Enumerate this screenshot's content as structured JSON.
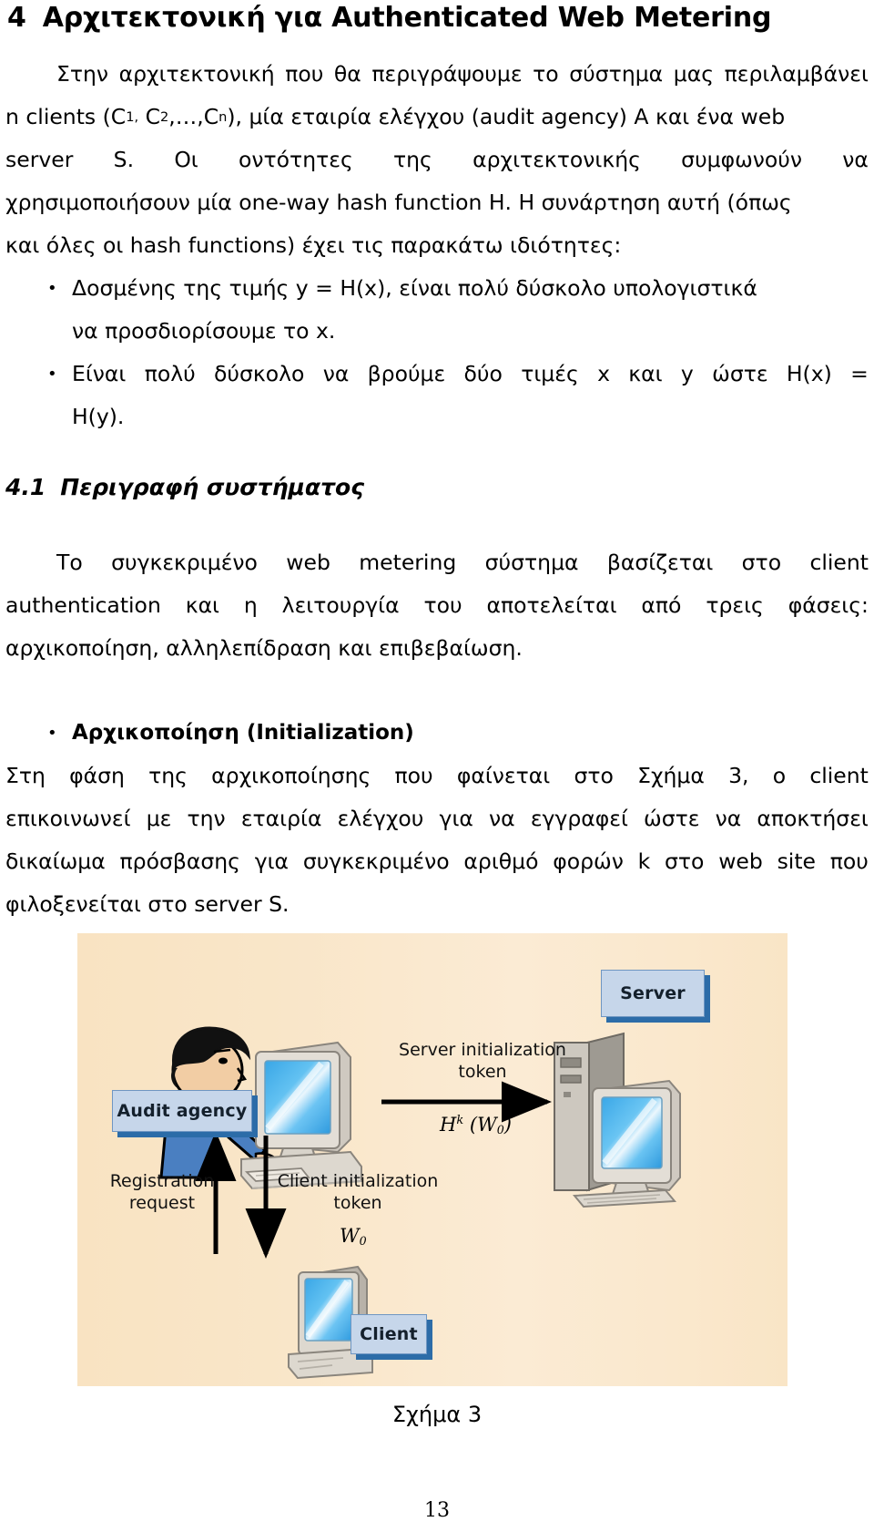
{
  "heading": {
    "number": "4",
    "text": "Αρχιτεκτονική για Authenticated Web Metering"
  },
  "intro_paragraph": {
    "line1_a": "Στην",
    "line1_b": "αρχιτεκτονική",
    "line1_c": "που",
    "line1_d": "θα",
    "line1_e": "περιγράψουμε",
    "line1_f": "το",
    "line1_g": "σύστημα",
    "line1_h": "μας",
    "line1_i": "περιλαμβάνει",
    "line2_a": "n clients (C",
    "line2_sub1": "1,",
    "line2_b": " C",
    "line2_sub2": "2",
    "line2_c": ",…,C",
    "line2_sub3": "n",
    "line2_d": "), μία εταιρία ελέγχου (audit agency) Α και ένα web",
    "line3_a": "server",
    "line3_b": "S.",
    "line3_c": "Οι",
    "line3_d": "οντότητες",
    "line3_e": "της",
    "line3_f": "αρχιτεκτονικής",
    "line3_g": "συμφωνούν",
    "line3_h": "να",
    "line4": "χρησιμοποιήσουν μία one-way hash function Η. Η συνάρτηση αυτή (όπως",
    "line5": "και όλες οι hash functions) έχει τις παρακάτω ιδιότητες:"
  },
  "hash_properties": {
    "bullet_glyph": "•",
    "item1_line1": "Δοσμένης της τιμής y = H(x), είναι πολύ δύσκολο υπολογιστικά",
    "item1_line2": "να προσδιορίσουμε το x.",
    "item2_line1_a": "Είναι",
    "item2_line1_b": "πολύ",
    "item2_line1_c": "δύσκολο",
    "item2_line1_d": "να",
    "item2_line1_e": "βρούμε",
    "item2_line1_f": "δύο",
    "item2_line1_g": "τιμές",
    "item2_line1_h": "x",
    "item2_line1_i": "και",
    "item2_line1_j": "y",
    "item2_line1_k": "ώστε",
    "item2_line1_l": "H(x)",
    "item2_line1_m": "=",
    "item2_line2": "H(y)."
  },
  "subheading": {
    "number": "4.1",
    "text": "Περιγραφή συστήματος"
  },
  "description_paragraph": {
    "line1_a": "Το",
    "line1_b": "συγκεκριμένο",
    "line1_c": "web",
    "line1_d": "metering",
    "line1_e": "σύστημα",
    "line1_f": "βασίζεται",
    "line1_g": "στο",
    "line1_h": "client",
    "line2_a": "authentication",
    "line2_b": "και",
    "line2_c": "η",
    "line2_d": "λειτουργία",
    "line2_e": "του",
    "line2_f": "αποτελείται",
    "line2_g": "από",
    "line2_h": "τρεις",
    "line2_i": "φάσεις:",
    "line3": "αρχικοποίηση, αλληλεπίδραση και επιβεβαίωση."
  },
  "phase_bullet": {
    "glyph": "•",
    "label": "Αρχικοποίηση (Initialization)"
  },
  "init_paragraph": {
    "line1_a": "Στη",
    "line1_b": "φάση",
    "line1_c": "της",
    "line1_d": "αρχικοποίησης",
    "line1_e": "που",
    "line1_f": "φαίνεται",
    "line1_g": "στο",
    "line1_h": "Σχήμα",
    "line1_i": "3,",
    "line1_j": "ο",
    "line1_k": "client",
    "line2_a": "επικοινωνεί",
    "line2_b": "με",
    "line2_c": "την",
    "line2_d": "εταιρία",
    "line2_e": "ελέγχου",
    "line2_f": "για",
    "line2_g": "να",
    "line2_h": "εγγραφεί",
    "line2_i": "ώστε",
    "line2_j": "να",
    "line2_k": "αποκτήσει",
    "line3_a": "δικαίωμα",
    "line3_b": "πρόσβασης",
    "line3_c": "για",
    "line3_d": "συγκεκριμένο",
    "line3_e": "αριθμό",
    "line3_f": "φορών",
    "line3_g": "k",
    "line3_h": "στο",
    "line3_i": "web",
    "line3_j": "site",
    "line3_k": "που",
    "line4": "φιλοξενείται στο server S."
  },
  "figure": {
    "caption": "Σχήμα 3",
    "background_color": "#f9e6c9",
    "tag_fill": "#c6d6ea",
    "tag_shadow": "#2c6ca8",
    "labels": {
      "audit_agency": "Audit agency",
      "server": "Server",
      "client": "Client",
      "server_init_line1": "Server initialization",
      "server_init_line2": "token",
      "server_init_formula_h": "H",
      "server_init_formula_k": "k",
      "server_init_formula_arg": "(W",
      "server_init_formula_sub": "0",
      "server_init_formula_close": ")",
      "registration_line1": "Registration",
      "registration_line2": "request",
      "client_init_line1": "Client initialization",
      "client_init_line2": "token",
      "client_init_formula_w": "W",
      "client_init_formula_sub": "0"
    }
  },
  "page_number": "13"
}
